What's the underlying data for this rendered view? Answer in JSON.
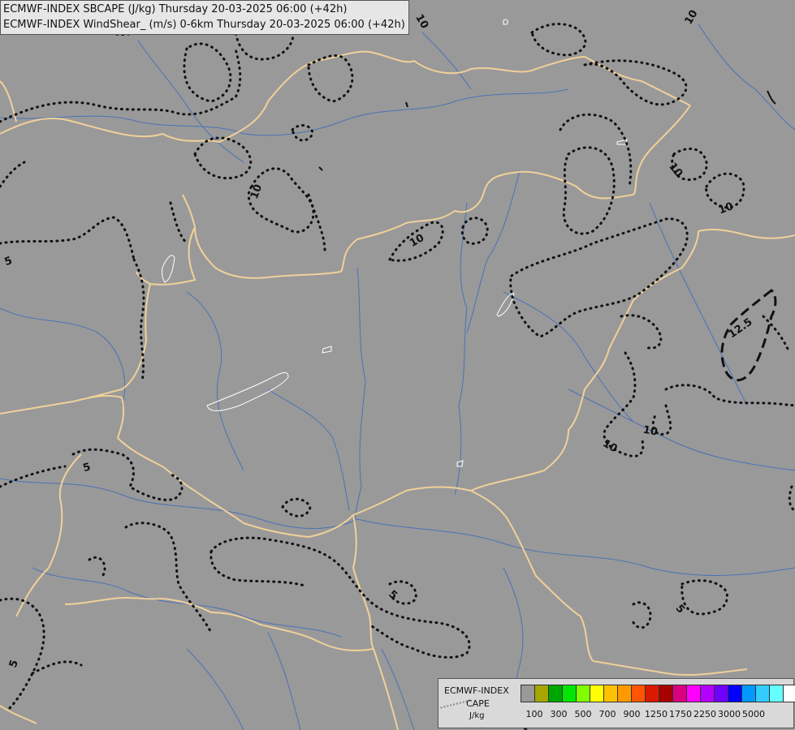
{
  "header": {
    "line1": "ECMWF-INDEX SBCAPE (J/kg) Thursday 20-03-2025 06:00 (+42h)",
    "line2": "ECMWF-INDEX WindShear_ (m/s) 0-6km Thursday 20-03-2025 06:00 (+42h)"
  },
  "contour_labels": [
    "10",
    "10",
    "10",
    "10",
    "10",
    "10",
    "10",
    "12.5",
    "5",
    "5",
    "5",
    "5",
    "5",
    "10"
  ],
  "legend": {
    "name": "ECMWF-INDEX",
    "variable": "CAPE",
    "unit": "J/kg",
    "colors": [
      "#999999",
      "#a6a600",
      "#00a600",
      "#00e600",
      "#80ff00",
      "#ffff00",
      "#ffc000",
      "#ff9900",
      "#ff5500",
      "#d91a00",
      "#a60000",
      "#d9007f",
      "#ff00ff",
      "#b300ff",
      "#7000ff",
      "#0000ff",
      "#0099ff",
      "#33ccff",
      "#66ffff",
      "#ffffff"
    ],
    "ticks": [
      "100",
      "300",
      "500",
      "700",
      "900",
      "1250",
      "1750",
      "2250",
      "3000",
      "5000"
    ]
  },
  "colors": {
    "background": "#999999",
    "borders": "#f0d09a",
    "rivers": "#4a72b5",
    "contours": "#000000",
    "lakes": "#ffffff"
  }
}
